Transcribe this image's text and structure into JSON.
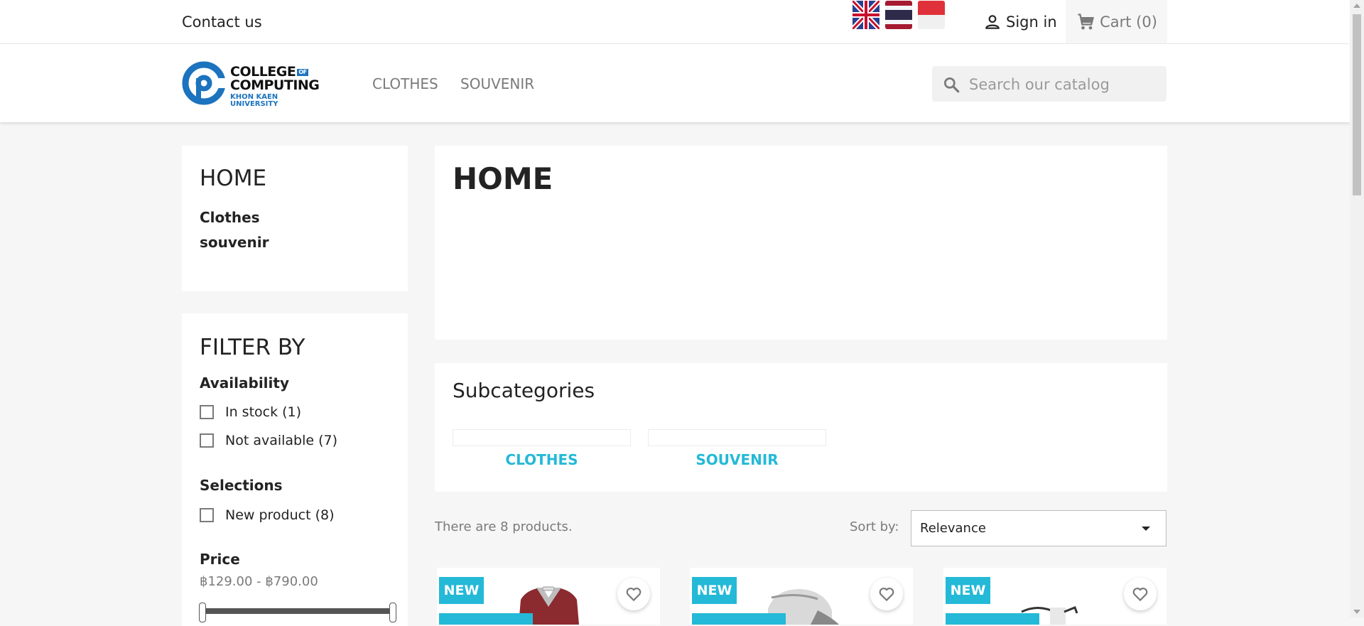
{
  "topbar": {
    "contact_label": "Contact us",
    "languages": [
      "English",
      "Thai",
      "Indonesian"
    ],
    "signin_label": "Sign in",
    "cart_label": "Cart (0)"
  },
  "header": {
    "logo": {
      "line1": "COLLEGE",
      "of": "OF",
      "line2": "COMPUTING",
      "line3": "KHON KAEN UNIVERSITY"
    },
    "nav": [
      "CLOTHES",
      "SOUVENIR"
    ],
    "search_placeholder": "Search our catalog"
  },
  "sidebar": {
    "home_title": "HOME",
    "categories": [
      "Clothes",
      "souvenir"
    ],
    "filter_title": "FILTER BY",
    "availability_title": "Availability",
    "availability_options": [
      "In stock (1)",
      "Not available (7)"
    ],
    "selections_title": "Selections",
    "selections_options": [
      "New product (8)"
    ],
    "price_title": "Price",
    "price_range": "฿129.00 - ฿790.00"
  },
  "main": {
    "title": "HOME",
    "subcategories_title": "Subcategories",
    "subcategories": [
      "CLOTHES",
      "SOUVENIR"
    ],
    "product_count": "There are 8 products.",
    "sort_label": "Sort by:",
    "sort_value": "Relevance"
  },
  "products": [
    {
      "badge": "NEW"
    },
    {
      "badge": "NEW"
    },
    {
      "badge": "NEW"
    }
  ],
  "colors": {
    "accent": "#24b9d7",
    "brand_blue": "#1c73be",
    "text": "#232323",
    "muted": "#7a7a7a"
  }
}
